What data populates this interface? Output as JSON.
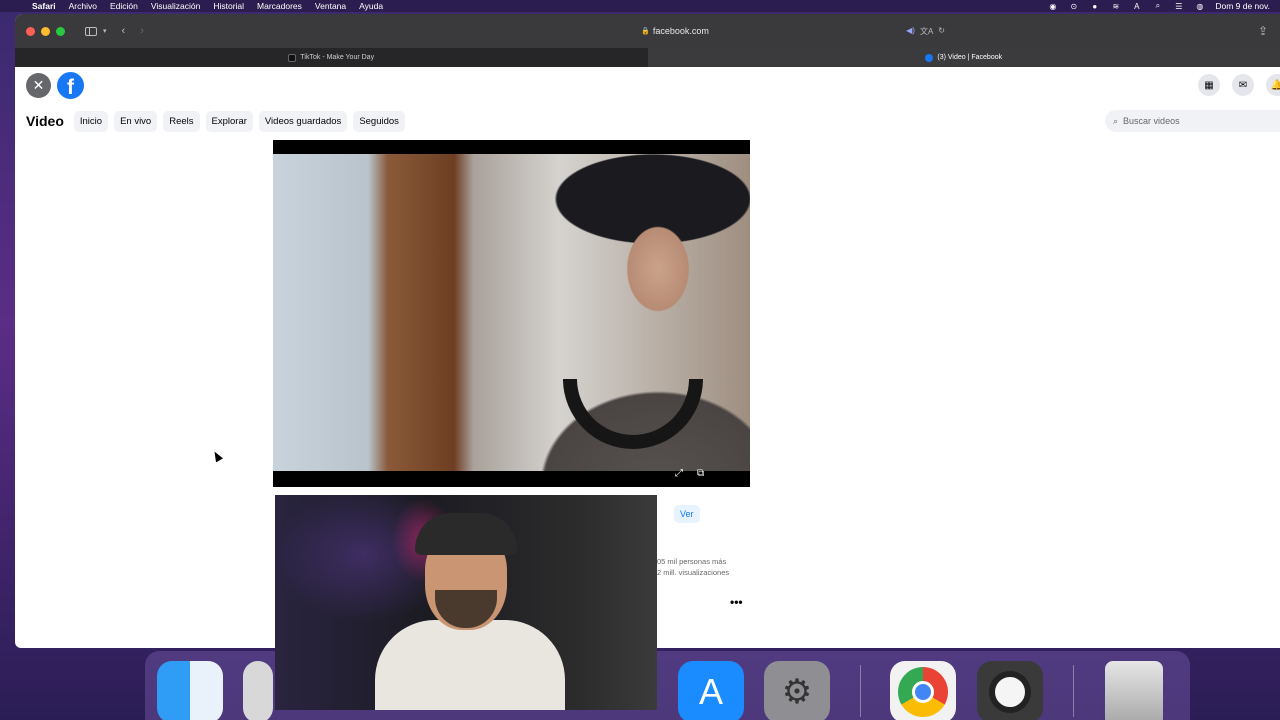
{
  "menubar": {
    "items": [
      "Safari",
      "Archivo",
      "Edición",
      "Visualización",
      "Historial",
      "Marcadores",
      "Ventana",
      "Ayuda"
    ],
    "clock": "Dom 9 de nov."
  },
  "browser": {
    "url": "facebook.com",
    "tabs": [
      {
        "label": "TikTok - Make Your Day"
      },
      {
        "label": "(3) Video | Facebook"
      }
    ]
  },
  "facebook": {
    "section_title": "Video",
    "nav": [
      "Inicio",
      "En vivo",
      "Reels",
      "Explorar",
      "Videos guardados",
      "Seguidos"
    ],
    "search_placeholder": "Buscar videos",
    "ver_label": "Ver",
    "stat_people": "05 mil personas más",
    "stat_views": "2 mill. visualizaciones",
    "more_label": "•••"
  },
  "icons": {
    "close": "close-icon",
    "logo": "facebook-logo",
    "menu": "grid-menu-icon",
    "messenger": "messenger-icon",
    "notifications": "bell-icon"
  },
  "colors": {
    "facebook_blue": "#1877f2",
    "link_blue": "#1877f2"
  }
}
